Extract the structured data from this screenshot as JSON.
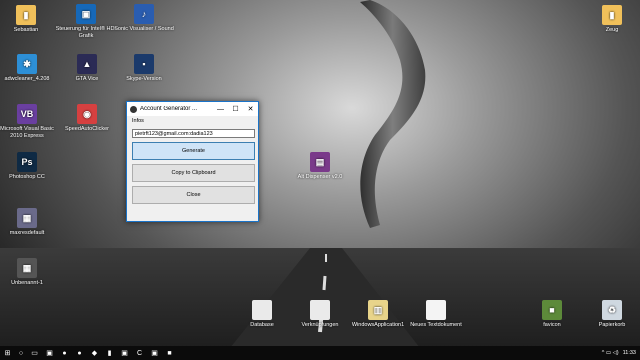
{
  "desktop": {
    "icons": [
      {
        "label": "Sebastian",
        "icon": "user-folder-icon",
        "color": "#f0c05a",
        "glyph": "▮"
      },
      {
        "label": "Steuerung für Intel® HD-Grafik",
        "icon": "intel-graphics-icon",
        "color": "#1668b8",
        "glyph": "▣"
      },
      {
        "label": "Sonic Visualiser / Sound",
        "icon": "app-shortcut-icon",
        "color": "#2a5db0",
        "glyph": "♪"
      },
      {
        "label": "adwcleaner_4.208",
        "icon": "adwcleaner-icon",
        "color": "#2d8fd6",
        "glyph": "✱"
      },
      {
        "label": "GTA Vice",
        "icon": "gta-icon",
        "color": "#2b2b55",
        "glyph": "▲"
      },
      {
        "label": "Skype-Version",
        "icon": "app-icon",
        "color": "#1b3a6b",
        "glyph": "▪"
      },
      {
        "label": "Microsoft Visual Basic 2010 Express",
        "icon": "visual-basic-icon",
        "color": "#6a3fa0",
        "glyph": "VB"
      },
      {
        "label": "SpeedAutoClicker",
        "icon": "mouse-icon",
        "color": "#d64040",
        "glyph": "◉"
      },
      {
        "label": "Photoshop CC",
        "icon": "photoshop-icon",
        "color": "#0f2a44",
        "glyph": "Ps"
      },
      {
        "label": "maxresdefault",
        "icon": "image-file-icon",
        "color": "#6a6a8a",
        "glyph": "▦"
      },
      {
        "label": "Unbenannt-1",
        "icon": "image-file-icon",
        "color": "#555",
        "glyph": "▦"
      },
      {
        "label": "Alt Dispenser v2.0",
        "icon": "winrar-icon",
        "color": "#7a3a8a",
        "glyph": "▤"
      },
      {
        "label": "Zeug",
        "icon": "folder-icon",
        "color": "#f0c05a",
        "glyph": "▮"
      },
      {
        "label": "Database",
        "icon": "document-icon",
        "color": "#eaeaea",
        "glyph": ""
      },
      {
        "label": "Verknüpfungen",
        "icon": "document-icon",
        "color": "#eaeaea",
        "glyph": ""
      },
      {
        "label": "WindowsApplication1",
        "icon": "project-file-icon",
        "color": "#e8d48a",
        "glyph": "▥"
      },
      {
        "label": "Neues Textdokument",
        "icon": "text-file-icon",
        "color": "#f4f4f4",
        "glyph": ""
      },
      {
        "label": "favicon",
        "icon": "minecraft-icon",
        "color": "#5d8a3a",
        "glyph": "■"
      },
      {
        "label": "Papierkorb",
        "icon": "recycle-bin-icon",
        "color": "#cfd8e0",
        "glyph": "♻"
      }
    ]
  },
  "window": {
    "title": "Account Generator ...",
    "min": "—",
    "max": "☐",
    "close": "✕",
    "menu": "Infos",
    "account_value": "pietrft123@gmail.com:dadia123",
    "generate_label": "Generate",
    "copy_label": "Copy to Clipboard",
    "close_label": "Close"
  },
  "taskbar": {
    "start": "⊞",
    "search": "○",
    "items": [
      "▭",
      "▣",
      "●",
      "●",
      "◆",
      "▮",
      "▣",
      "C",
      "▣",
      "■"
    ],
    "tray_icons": "^ ▭ ◁)",
    "clock": "11:33"
  }
}
